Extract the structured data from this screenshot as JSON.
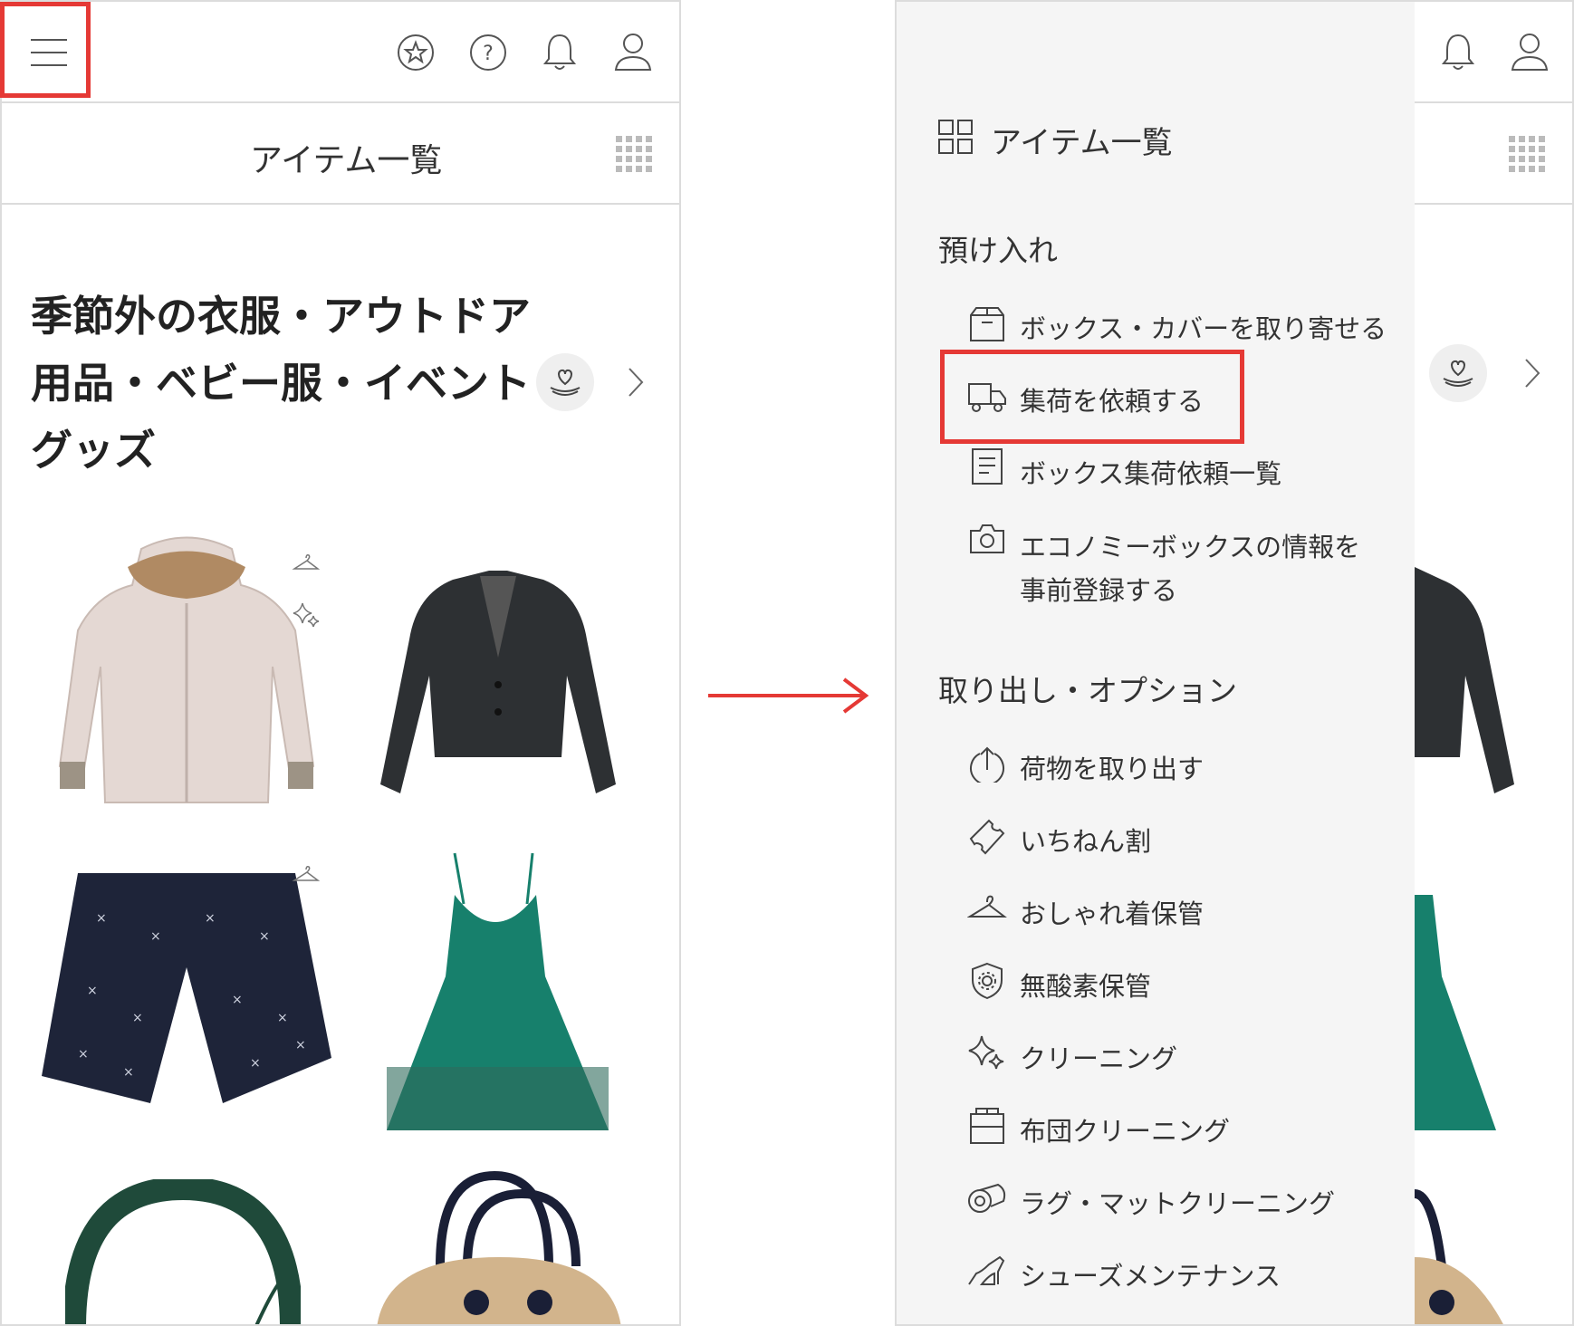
{
  "left": {
    "header_title": "アイテム一覧",
    "section_title_lines": [
      "季節外の衣服・アウトドア",
      "用品・ベビー服・イベント",
      "グッズ"
    ],
    "icons": {
      "menu": "hamburger-menu-icon",
      "favorite": "star-circle-icon",
      "help": "question-circle-icon",
      "notifications": "bell-icon",
      "account": "person-icon",
      "grid": "grid-dots-icon",
      "care": "heart-hand-icon",
      "next": "chevron-right-icon"
    },
    "items": [
      {
        "name": "down-jacket-item",
        "icons": [
          "hanger-icon",
          "sparkle-icon"
        ],
        "color": "#e4d8d3"
      },
      {
        "name": "black-blazer-item",
        "icons": [],
        "color": "#2d3033"
      },
      {
        "name": "navy-shorts-item",
        "icons": [
          "hanger-icon"
        ],
        "color": "#1e2439"
      },
      {
        "name": "green-dress-item",
        "icons": [],
        "color": "#17806c"
      },
      {
        "name": "headphones-item",
        "icons": [],
        "color": "#1f4a3a"
      },
      {
        "name": "basket-bag-item",
        "icons": [],
        "color": "#d2b48c"
      }
    ]
  },
  "right": {
    "header_title": "アイテム一覧",
    "sections": [
      {
        "title": "預け入れ",
        "items": [
          {
            "label": "ボックス・カバーを取り寄せる",
            "icon": "box-icon"
          },
          {
            "label": "集荷を依頼する",
            "icon": "truck-icon",
            "highlighted": true
          },
          {
            "label": "ボックス集荷依頼一覧",
            "icon": "document-list-icon"
          },
          {
            "label": "エコノミーボックスの情報を",
            "label2": "事前登録する",
            "icon": "camera-icon"
          }
        ]
      },
      {
        "title": "取り出し・オプション",
        "items": [
          {
            "label": "荷物を取り出す",
            "icon": "upload-arrow-icon"
          },
          {
            "label": "いちねん割",
            "icon": "ticket-icon"
          },
          {
            "label": "おしゃれ着保管",
            "icon": "hanger-icon"
          },
          {
            "label": "無酸素保管",
            "icon": "shield-gear-icon"
          },
          {
            "label": "クリーニング",
            "icon": "sparkle-icon"
          },
          {
            "label": "布団クリーニング",
            "icon": "futon-icon"
          },
          {
            "label": "ラグ・マットクリーニング",
            "icon": "rug-roll-icon"
          },
          {
            "label": "シューズメンテナンス",
            "icon": "shoe-icon"
          }
        ]
      }
    ]
  },
  "colors": {
    "highlight": "#e53935",
    "arrow": "#e53935",
    "drawer_bg": "#f5f5f5",
    "border": "#dcdcdc"
  }
}
